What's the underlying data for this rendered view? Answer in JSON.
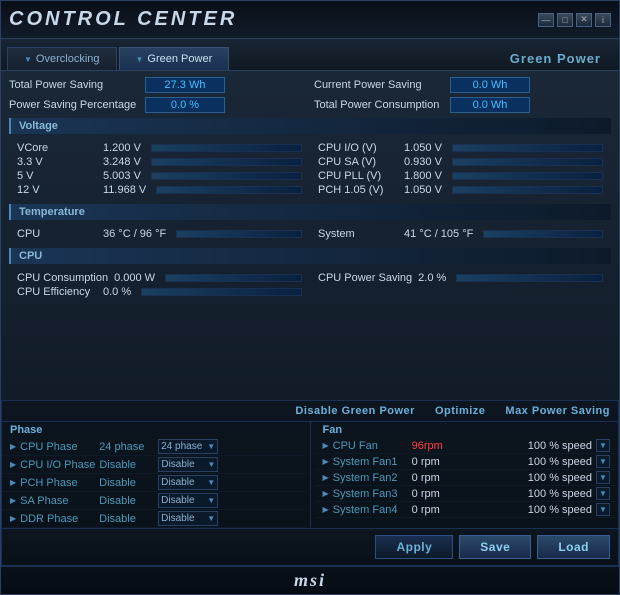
{
  "window": {
    "title": "Control Center",
    "controls": [
      "—",
      "□",
      "✕",
      "i"
    ]
  },
  "tabs": [
    {
      "label": "Overclocking",
      "active": false
    },
    {
      "label": "Green Power",
      "active": true
    }
  ],
  "section_label": "Green Power",
  "power_stats": {
    "total_power_saving_label": "Total Power Saving",
    "total_power_saving_value": "27.3 Wh",
    "power_saving_pct_label": "Power Saving Percentage",
    "power_saving_pct_value": "0.0 %",
    "current_power_saving_label": "Current Power Saving",
    "current_power_saving_value": "0.0 Wh",
    "total_power_consumption_label": "Total Power Consumption",
    "total_power_consumption_value": "0.0 Wh"
  },
  "voltage_section": {
    "header": "Voltage",
    "items": [
      {
        "key": "VCore",
        "val": "1.200 V"
      },
      {
        "key": "CPU I/O (V)",
        "val": "1.050 V"
      },
      {
        "key": "3.3 V",
        "val": "3.248 V"
      },
      {
        "key": "CPU SA (V)",
        "val": "0.930 V"
      },
      {
        "key": "5 V",
        "val": "5.003 V"
      },
      {
        "key": "CPU PLL (V)",
        "val": "1.800 V"
      },
      {
        "key": "12 V",
        "val": "11.968 V"
      },
      {
        "key": "PCH 1.05 (V)",
        "val": "1.050 V"
      }
    ]
  },
  "temperature_section": {
    "header": "Temperature",
    "items": [
      {
        "key": "CPU",
        "val": "36 °C / 96 °F"
      },
      {
        "key": "System",
        "val": "41 °C / 105 °F"
      }
    ]
  },
  "cpu_section": {
    "header": "CPU",
    "items": [
      {
        "key": "CPU Consumption",
        "val": "0.000 W"
      },
      {
        "key": "CPU Power Saving",
        "val": "2.0 %"
      },
      {
        "key": "CPU Efficiency",
        "val": "0.0 %"
      },
      {
        "key": "",
        "val": ""
      }
    ]
  },
  "bottom_headers": {
    "disable": "Disable Green Power",
    "optimize": "Optimize",
    "max_power": "Max Power Saving"
  },
  "phase_col_header": "Phase",
  "fan_col_header": "Fan",
  "phase_rows": [
    {
      "label": "CPU Phase",
      "value": "24 phase",
      "select": "24 phase",
      "value_color": "blue"
    },
    {
      "label": "CPU I/O Phase",
      "value": "Disable",
      "select": "Disable",
      "value_color": "blue"
    },
    {
      "label": "PCH Phase",
      "value": "Disable",
      "select": "Disable",
      "value_color": "blue"
    },
    {
      "label": "SA Phase",
      "value": "Disable",
      "select": "Disable",
      "value_color": "blue"
    },
    {
      "label": "DDR Phase",
      "value": "Disable",
      "select": "Disable",
      "value_color": "blue"
    }
  ],
  "fan_rows": [
    {
      "label": "CPU Fan",
      "value": "96rpm",
      "speed": "100 % speed",
      "value_color": "red"
    },
    {
      "label": "System Fan1",
      "value": "0 rpm",
      "speed": "100 % speed",
      "value_color": "normal"
    },
    {
      "label": "System Fan2",
      "value": "0 rpm",
      "speed": "100 % speed",
      "value_color": "normal"
    },
    {
      "label": "System Fan3",
      "value": "0 rpm",
      "speed": "100 % speed",
      "value_color": "normal"
    },
    {
      "label": "System Fan4",
      "value": "0 rpm",
      "speed": "100 % speed",
      "value_color": "normal"
    }
  ],
  "buttons": {
    "apply": "Apply",
    "save": "Save",
    "load": "Load"
  },
  "msi_logo": "msi"
}
